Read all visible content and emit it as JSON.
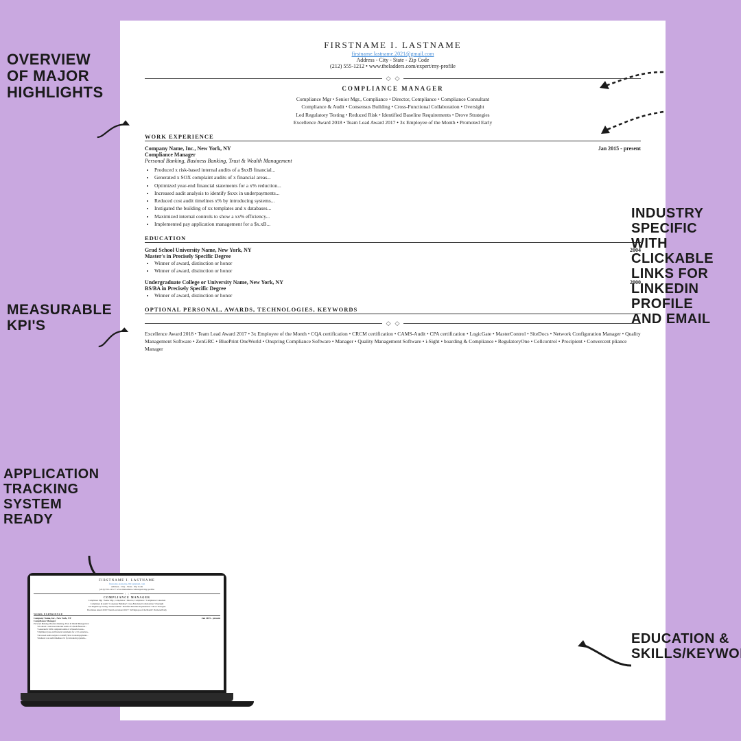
{
  "background_color": "#c9a8e0",
  "annotations": {
    "overview": "OVERVIEW\nOF MAJOR\nHIGHLIGHTS",
    "measurable": "MEASURABLE\nKPI'S",
    "ats": "APPLICATION\nTRACKING\nSYSTEM\nREADY",
    "industry": "INDUSTRY\nSPECIFIC\nWITH\nCLICKABLE\nLINKS FOR\nLINKEDIN\nPROFILE\nAND EMAIL",
    "education": "EDUCATION &\nSKILLS/KEYWORDS"
  },
  "resume": {
    "name": "FIRSTNAME I. LASTNAME",
    "email": "firstname.lastname.2021@gmail.com",
    "address": "Address - City - State - Zip Code",
    "phone": "(212) 555-1212 • www.theladders.com/expert/my-profile",
    "title": "COMPLIANCE MANAGER",
    "keywords_line1": "Compliance Mgr • Senior Mgr., Compliance • Director, Compliance • Compliance Consultant",
    "keywords_line2": "Compliance & Audit • Consensus Building • Cross-Functional Collaboration • Oversight",
    "keywords_line3": "Led Regulatory Testing • Reduced Risk • Identified Baseline Requirements • Drove Strategies",
    "keywords_line4": "Excellence Award 2018 • Team Lead Award 2017 • 3x Employee of the Month • Promoted Early",
    "work_experience_header": "WORK EXPERIENCE",
    "job1": {
      "company": "Company Name, Inc., New York, NY",
      "dates": "Jan 2015 - present",
      "title": "Compliance Manager",
      "subtitle": "Personal Banking, Business Banking, Trust & Wealth Management",
      "bullets": [
        "Produced x risk-based internal audits of a $xxB financial...",
        "Generated x SOX complaint audits of x financial areas...",
        "Optimized year-end financial statements for a x% reduction...",
        "Increased audit analysis to identify $xxx in underpayments...",
        "Reduced cost audit timelines x% by introducing systems...",
        "Instigated the building of xx templates and x databases...",
        "Maximized internal controls to show a xx% efficiency...",
        "Implemented pay application management for a $x.xB..."
      ]
    },
    "education_header": "EDUCATION",
    "edu1": {
      "school": "Grad School University Name, New York, NY",
      "year": "2004",
      "degree": "Master's in Precisely Specific Degree",
      "bullets": [
        "Winner of award, distinction or honor",
        "Winner of award, distinction or honor"
      ]
    },
    "edu2": {
      "school": "Undergraduate College or University Name, New York, NY",
      "year": "2000",
      "degree": "BS/BA in Precisely Specific Degree",
      "bullets": [
        "Winner of award, distinction or honor"
      ]
    },
    "optional_header": "OPTIONAL PERSONAL, AWARDS, TECHNOLOGIES, KEYWORDS",
    "optional_text": "Excellence Award 2018 • Team Lead Award 2017 • 3x Employee of the Month • CQA certification • CRCM certification • CAMS-Audit • CPA certification • LogicGate • MasterControl • SiteDocs • Network Configuration Manager • Quality Management Software • ZenGRC • BluePrint OneWorld • Onspring Compliance Software • Manager • Quality Management Software • i-Sight • boarding & Compliance • RegulatoryOne • Cellcontrol • Procipient • Convercent pliance Manager"
  }
}
